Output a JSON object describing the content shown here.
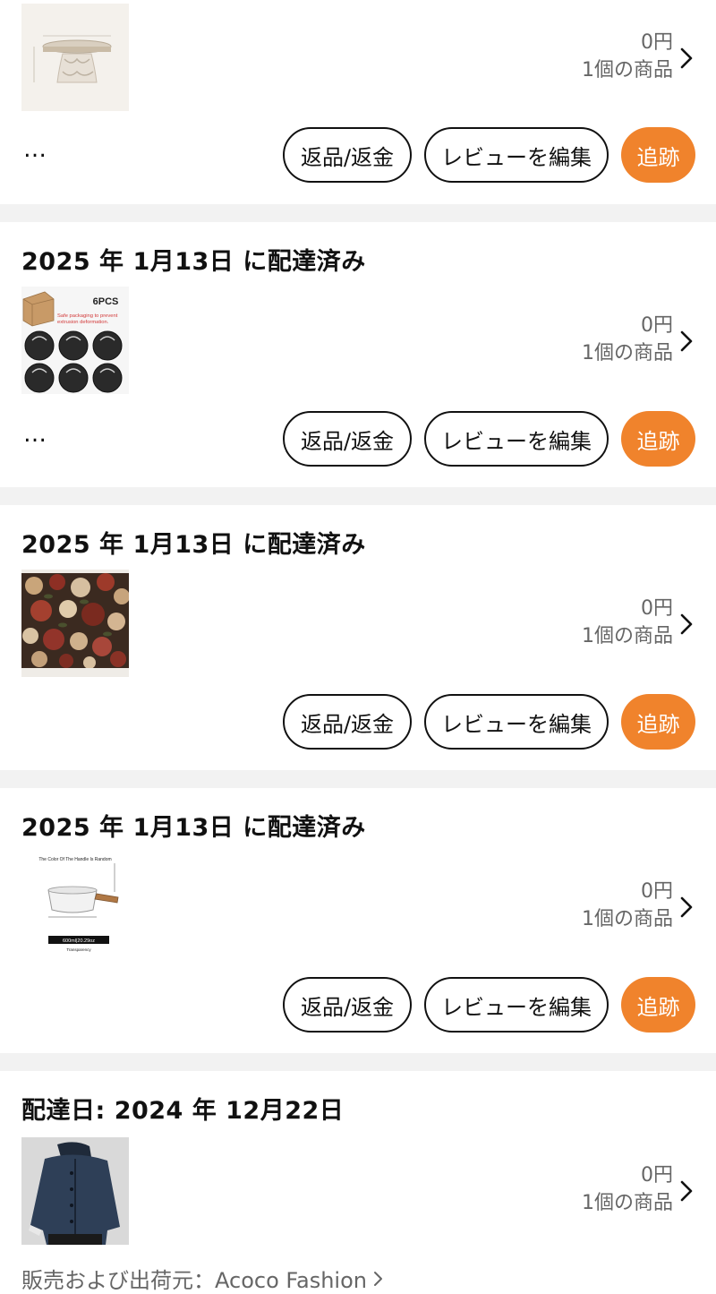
{
  "orders": [
    {
      "title": "",
      "price": "0円",
      "count": "1個の商品",
      "has_more": true,
      "product_icon": "round-wooden-stand",
      "buttons": {
        "return": "返品/返金",
        "review": "レビューを編集",
        "track": "追跡"
      }
    },
    {
      "title": "2025 年 1月13日 に配達済み",
      "price": "0円",
      "count": "1個の商品",
      "has_more": true,
      "product_icon": "tart-pans-6pcs",
      "product_label": "6PCS",
      "product_caption": "Safe packaging to prevent extrusion deformation.",
      "buttons": {
        "return": "返品/返金",
        "review": "レビューを編集",
        "track": "追跡"
      }
    },
    {
      "title": "2025 年 1月13日 に配達済み",
      "price": "0円",
      "count": "1個の商品",
      "has_more": false,
      "product_icon": "floral-fabric-print",
      "buttons": {
        "return": "返品/返金",
        "review": "レビューを編集",
        "track": "追跡"
      }
    },
    {
      "title": "2025 年 1月13日 に配達済み",
      "price": "0円",
      "count": "1個の商品",
      "has_more": false,
      "product_icon": "milk-pan-wooden-handle",
      "product_caption": "The Color Of The Handle Is Random",
      "product_label": "600ml|20.29oz",
      "product_subcaption": "Transparency",
      "buttons": {
        "return": "返品/返金",
        "review": "レビューを編集",
        "track": "追跡"
      }
    },
    {
      "title": "配達日: 2024 年 12月22日",
      "price": "0円",
      "count": "1個の商品",
      "has_more": false,
      "product_icon": "denim-jacket",
      "seller": "販売および出荷元：Acoco Fashion"
    }
  ],
  "icons": {
    "more": "…",
    "chevron": "chevron-right-icon"
  },
  "colors": {
    "accent": "#f0832c",
    "background": "#f2f2f2",
    "card": "#ffffff",
    "muted_text": "#666666"
  }
}
